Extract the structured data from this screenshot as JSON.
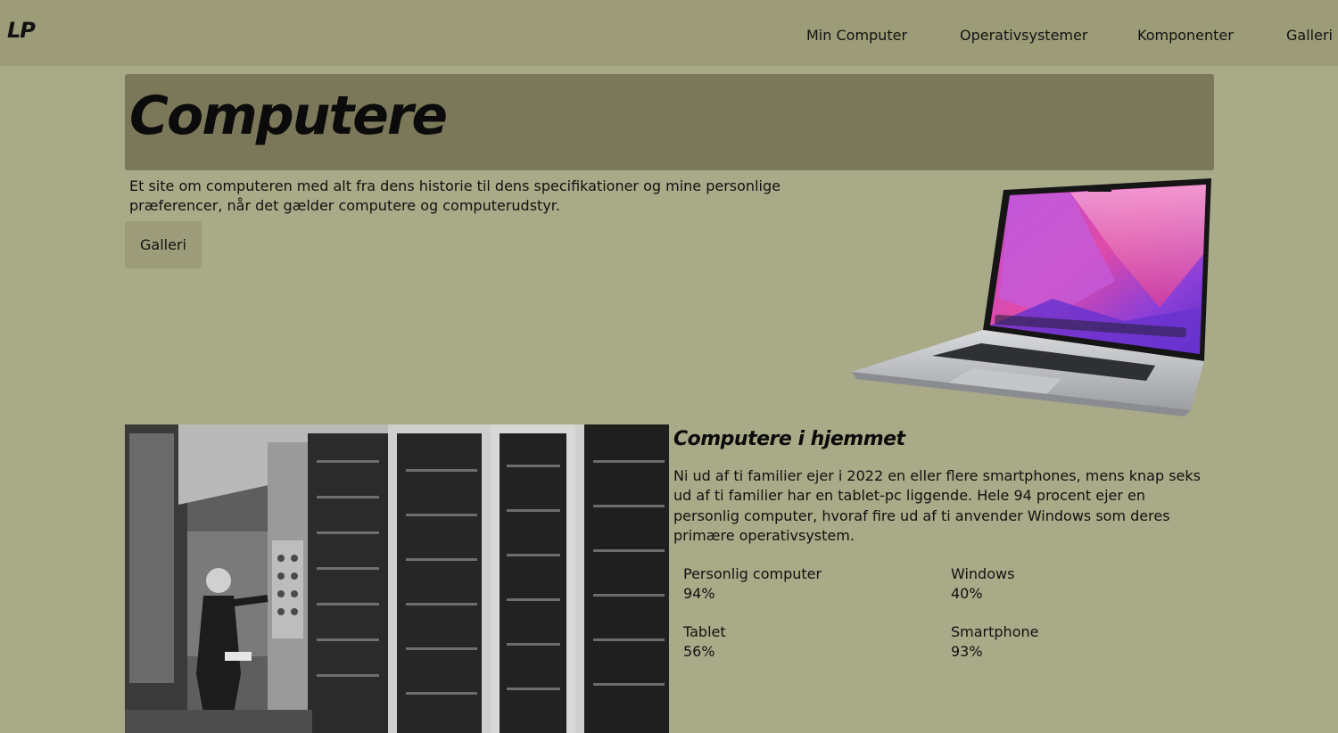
{
  "header": {
    "logo": "LP",
    "nav": [
      {
        "label": "Min Computer"
      },
      {
        "label": "Operativsystemer"
      },
      {
        "label": "Komponenter"
      },
      {
        "label": "Galleri"
      }
    ]
  },
  "hero": {
    "title": "Computere",
    "intro": "Et site om computeren med alt fra dens historie til dens specifikationer og mine personlige præferencer, når det gælder computere og computerudstyr.",
    "button_label": "Galleri"
  },
  "section": {
    "title": "Computere i hjemmet",
    "text": "Ni ud af ti familier ejer i 2022 en eller flere smartphones, mens knap seks ud af ti familier har en tablet-pc liggende. Hele 94 procent ejer en personlig computer, hvoraf fire ud af ti anvender Windows som deres primære operativsystem.",
    "stats": [
      {
        "label": "Personlig computer",
        "value": "94%"
      },
      {
        "label": "Windows",
        "value": "40%"
      },
      {
        "label": "Tablet",
        "value": "56%"
      },
      {
        "label": "Smartphone",
        "value": "93%"
      }
    ]
  },
  "colors": {
    "page_bg": "#a9aa87",
    "header_bg": "#9d9c78",
    "banner_bg": "#7b785a",
    "button_bg": "#9d9c7a"
  }
}
